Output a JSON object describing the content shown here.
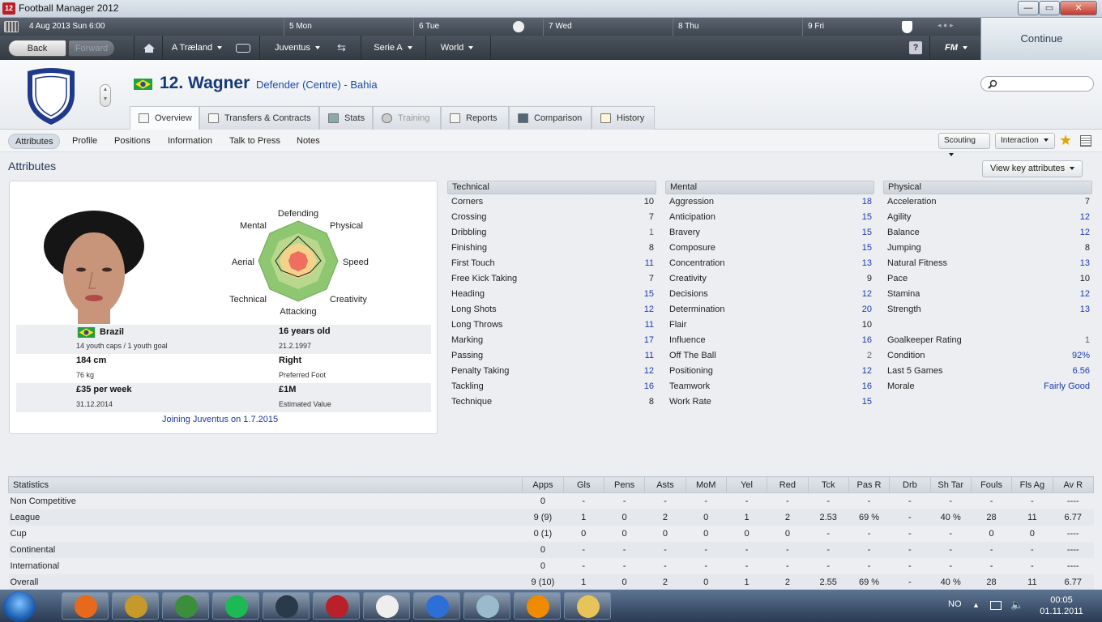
{
  "window": {
    "title": "Football Manager 2012",
    "app_badge": "12",
    "minimize": "—",
    "maximize": "▭",
    "close": "✕"
  },
  "datebar": {
    "current": "4 Aug 2013  Sun  6:00",
    "days": [
      "5  Mon",
      "6  Tue",
      "7  Wed",
      "8  Thu",
      "9  Fri"
    ]
  },
  "nav": {
    "back": "Back",
    "forward": "Forward",
    "items": [
      "A Træland",
      "Juventus",
      "Serie A",
      "World"
    ],
    "help": "?",
    "fm_menu": "FM",
    "continue": "Continue"
  },
  "player": {
    "name": "12. Wagner",
    "position": "Defender (Centre) - Bahia"
  },
  "tabs": [
    "Overview",
    "Transfers & Contracts",
    "Stats",
    "Training",
    "Reports",
    "Comparison",
    "History"
  ],
  "subnav": [
    "Attributes",
    "Profile",
    "Positions",
    "Information",
    "Talk to Press",
    "Notes"
  ],
  "top_buttons": {
    "scouting": "Scouting",
    "interaction": "Interaction",
    "star": "★"
  },
  "section_title": "Attributes",
  "view_key_attributes": "View key attributes",
  "radar_labels": {
    "defending": "Defending",
    "physical": "Physical",
    "speed": "Speed",
    "creativity": "Creativity",
    "attacking": "Attacking",
    "technical": "Technical",
    "aerial": "Aerial",
    "mental": "Mental"
  },
  "info": {
    "nationality": "Brazil",
    "caps": "14 youth caps / 1 youth goal",
    "age": "16 years old",
    "dob": "21.2.1997",
    "height": "184 cm",
    "weight": "76 kg",
    "foot": "Right",
    "foot_label": "Preferred Foot",
    "wage": "£35 per week",
    "contract": "31.12.2014",
    "value": "£1M",
    "value_label": "Estimated Value",
    "joining": "Joining Juventus on 1.7.2015"
  },
  "attributes": {
    "technical": {
      "title": "Technical",
      "rows": [
        [
          "Corners",
          "10"
        ],
        [
          "Crossing",
          "7"
        ],
        [
          "Dribbling",
          "1"
        ],
        [
          "Finishing",
          "8"
        ],
        [
          "First Touch",
          "11"
        ],
        [
          "Free Kick Taking",
          "7"
        ],
        [
          "Heading",
          "15"
        ],
        [
          "Long Shots",
          "12"
        ],
        [
          "Long Throws",
          "11"
        ],
        [
          "Marking",
          "17"
        ],
        [
          "Passing",
          "11"
        ],
        [
          "Penalty Taking",
          "12"
        ],
        [
          "Tackling",
          "16"
        ],
        [
          "Technique",
          "8"
        ]
      ]
    },
    "mental": {
      "title": "Mental",
      "rows": [
        [
          "Aggression",
          "18"
        ],
        [
          "Anticipation",
          "15"
        ],
        [
          "Bravery",
          "15"
        ],
        [
          "Composure",
          "15"
        ],
        [
          "Concentration",
          "13"
        ],
        [
          "Creativity",
          "9"
        ],
        [
          "Decisions",
          "12"
        ],
        [
          "Determination",
          "20"
        ],
        [
          "Flair",
          "10"
        ],
        [
          "Influence",
          "16"
        ],
        [
          "Off The Ball",
          "2"
        ],
        [
          "Positioning",
          "12"
        ],
        [
          "Teamwork",
          "16"
        ],
        [
          "Work Rate",
          "15"
        ]
      ]
    },
    "physical": {
      "title": "Physical",
      "rows": [
        [
          "Acceleration",
          "7"
        ],
        [
          "Agility",
          "12"
        ],
        [
          "Balance",
          "12"
        ],
        [
          "Jumping",
          "8"
        ],
        [
          "Natural Fitness",
          "13"
        ],
        [
          "Pace",
          "10"
        ],
        [
          "Stamina",
          "12"
        ],
        [
          "Strength",
          "13"
        ]
      ]
    },
    "extra": [
      [
        "Goalkeeper Rating",
        "1"
      ],
      [
        "Condition",
        "92%"
      ],
      [
        "Last 5 Games",
        "6.56"
      ],
      [
        "Morale",
        "Fairly Good"
      ]
    ]
  },
  "stats": {
    "headers": [
      "Statistics",
      "Apps",
      "Gls",
      "Pens",
      "Asts",
      "MoM",
      "Yel",
      "Red",
      "Tck",
      "Pas R",
      "Drb",
      "Sh Tar",
      "Fouls",
      "Fls Ag",
      "Av R"
    ],
    "rows": [
      [
        "Non Competitive",
        "0",
        "-",
        "-",
        "-",
        "-",
        "-",
        "-",
        "-",
        "-",
        "-",
        "-",
        "-",
        "-",
        "----"
      ],
      [
        "League",
        "9 (9)",
        "1",
        "0",
        "2",
        "0",
        "1",
        "2",
        "2.53",
        "69 %",
        "-",
        "40 %",
        "28",
        "11",
        "6.77"
      ],
      [
        "Cup",
        "0 (1)",
        "0",
        "0",
        "0",
        "0",
        "0",
        "0",
        "-",
        "-",
        "-",
        "-",
        "0",
        "0",
        "----"
      ],
      [
        "Continental",
        "0",
        "-",
        "-",
        "-",
        "-",
        "-",
        "-",
        "-",
        "-",
        "-",
        "-",
        "-",
        "-",
        "----"
      ],
      [
        "International",
        "0",
        "-",
        "-",
        "-",
        "-",
        "-",
        "-",
        "-",
        "-",
        "-",
        "-",
        "-",
        "-",
        "----"
      ],
      [
        "Overall",
        "9 (10)",
        "1",
        "0",
        "2",
        "0",
        "1",
        "2",
        "2.55",
        "69 %",
        "-",
        "40 %",
        "28",
        "11",
        "6.77"
      ]
    ]
  },
  "taskbar": {
    "apps": [
      "firefox-icon",
      "wow-icon",
      "messenger-icon",
      "spotify-icon",
      "steam-icon",
      "fm2012-icon",
      "notepad-icon",
      "itunes-icon",
      "paint-icon",
      "vlc-icon",
      "explorer-icon"
    ],
    "lang": "NO",
    "time": "00:05",
    "date": "01.11.2011"
  },
  "colors": {
    "highlight": "#1a3b9f",
    "title_blue": "#16387a"
  }
}
